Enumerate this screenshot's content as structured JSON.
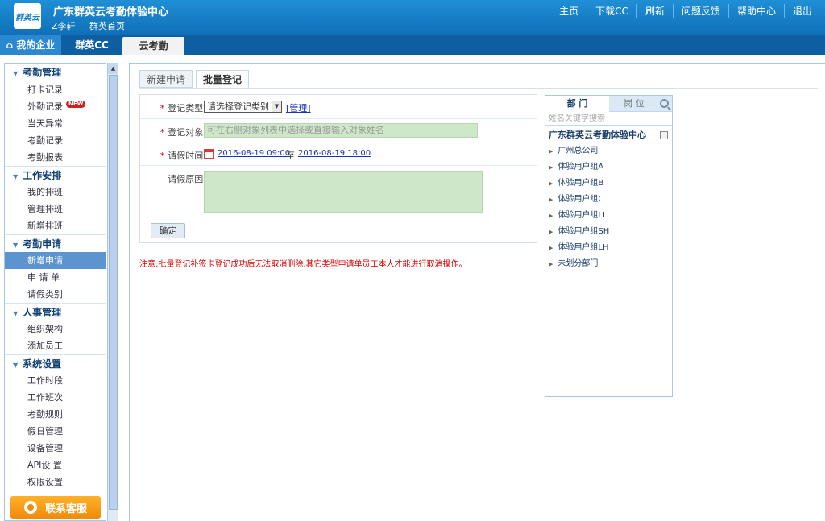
{
  "header": {
    "logo_text": "群英云",
    "app_title": "广东群英云考勤体验中心",
    "user_name": "Z李轩",
    "home_link": "群英首页",
    "nav": [
      "主页",
      "下载CC",
      "刷新",
      "问题反馈",
      "帮助中心",
      "退出"
    ]
  },
  "tabs": {
    "mine": "我的企业",
    "cc": "群英CC",
    "yun": "云考勤"
  },
  "sidebar": {
    "groups": [
      {
        "title": "考勤管理",
        "items": [
          "打卡记录",
          "外勤记录",
          "当天异常",
          "考勤记录",
          "考勤报表"
        ]
      },
      {
        "title": "工作安排",
        "items": [
          "我的排班",
          "管理排班",
          "新增排班"
        ]
      },
      {
        "title": "考勤申请",
        "items": [
          "新增申请",
          "申 请 单",
          "请假类别"
        ]
      },
      {
        "title": "人事管理",
        "items": [
          "组织架构",
          "添加员工"
        ]
      },
      {
        "title": "系统设置",
        "items": [
          "工作时段",
          "工作班次",
          "考勤规则",
          "假日管理",
          "设备管理",
          "API设 置",
          "权限设置"
        ]
      }
    ],
    "new_badge": "NEW",
    "active_item": "新增申请",
    "service_button": "联系客服"
  },
  "subtabs": {
    "new_request": "新建申请",
    "batch": "批量登记"
  },
  "form": {
    "req_mark": "*",
    "type_label": "登记类型:",
    "type_value": "请选择登记类别",
    "manage_link": "[管理]",
    "target_label": "登记对象:",
    "target_placeholder": "可在右侧对象列表中选择或直接输入对象姓名",
    "time_label": "请假时间:",
    "start_time": "2016-08-19 09:00",
    "to_text": "至",
    "end_time": "2016-08-19 18:00",
    "reason_label": "请假原因:",
    "confirm_button": "确定"
  },
  "notice": "注意:批量登记补签卡登记成功后无法取消删除,其它类型申请单员工本人才能进行取消操作。",
  "picker": {
    "tab_dept": "部  门",
    "tab_post": "岗  位",
    "search_placeholder": "姓名关键字搜索",
    "root": "广东群英云考勤体验中心",
    "departments": [
      "广州总公司",
      "体验用户组A",
      "体验用户组B",
      "体验用户组C",
      "体验用户组LI",
      "体验用户组SH",
      "体验用户组LH",
      "未划分部门"
    ]
  },
  "colors": {
    "header_blue": "#1f8fd6",
    "tabbar_dark": "#0e5fa2",
    "active_item": "#5b94cf",
    "input_green": "#cde7c8",
    "notice_red": "#d40000",
    "service_orange": "#f08a0a"
  }
}
